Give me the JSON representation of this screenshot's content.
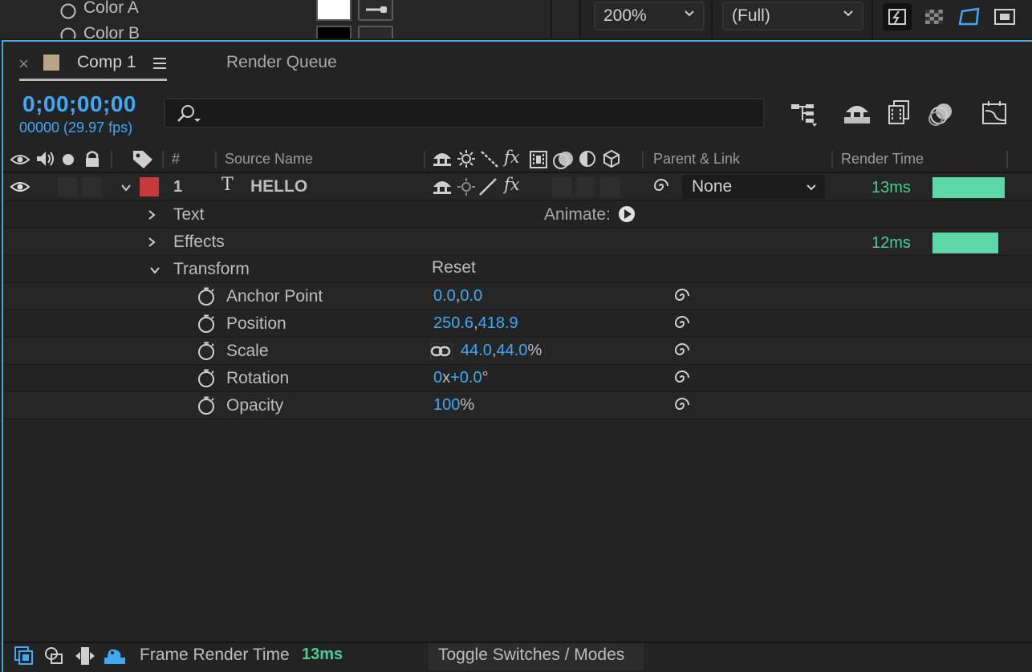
{
  "top_strip": {
    "effect_label": "Color A",
    "effect_label_2": "Color B",
    "zoom": "200%",
    "resolution": "(Full)"
  },
  "tabs": {
    "comp": "Comp 1",
    "render_queue": "Render Queue",
    "close_glyph": "×",
    "comp_color": "#b9a583"
  },
  "timecode": "0;00;00;00",
  "frame_fps": "00000 (29.97 fps)",
  "columns": {
    "number": "#",
    "source_name": "Source Name",
    "parent_link": "Parent & Link",
    "render_time": "Render Time"
  },
  "layer": {
    "number": "1",
    "type_icon": "T",
    "name": "HELLO",
    "label_color": "#c83a3a",
    "parent": "None",
    "render_time": "13ms"
  },
  "groups": {
    "text": "Text",
    "animate": "Animate:",
    "effects": "Effects",
    "effects_render_time": "12ms",
    "transform": "Transform",
    "reset": "Reset"
  },
  "properties": [
    {
      "name": "Anchor Point",
      "v1": "0.0",
      "sep": ",",
      "v2": "0.0",
      "unit": ""
    },
    {
      "name": "Position",
      "v1": "250.6",
      "sep": ",",
      "v2": "418.9",
      "unit": ""
    },
    {
      "name": "Scale",
      "v1": "44.0",
      "sep": ",",
      "v2": "44.0",
      "unit": "%"
    },
    {
      "name": "Rotation",
      "v1": "0",
      "sep": "x",
      "v2": "+0.0",
      "unit": "°"
    },
    {
      "name": "Opacity",
      "v1": "100",
      "sep": "",
      "v2": "",
      "unit": "%"
    }
  ],
  "bottom": {
    "frame_render_label": "Frame Render Time",
    "frame_render_value": "13ms",
    "toggle_label": "Toggle Switches / Modes"
  },
  "colors": {
    "accent_blue": "#3fa9f5",
    "render_bar": "#5dd6a8",
    "panel_border": "#4aa8d8"
  }
}
